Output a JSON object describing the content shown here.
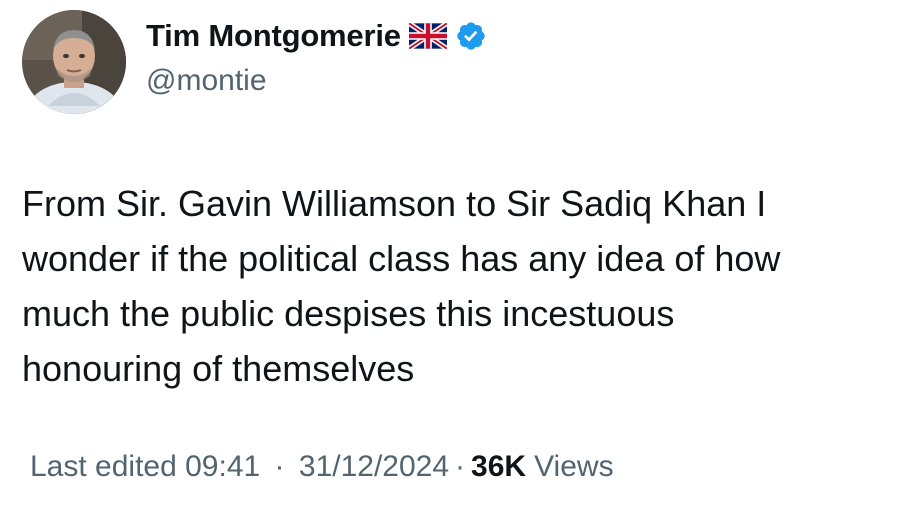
{
  "author": {
    "display_name": "Tim Montgomerie",
    "handle": "@montie",
    "flag_icon": "uk-flag-icon",
    "verified_icon": "verified-badge-icon",
    "verified_color": "#1d9bf0"
  },
  "tweet": {
    "lines": [
      "From Sir. Gavin Williamson to Sir Sadiq Khan I",
      "wonder if the political class has any idea of how",
      "much the public despises this incestuous",
      "honouring of themselves"
    ]
  },
  "meta": {
    "edited_label": "Last edited",
    "time": "09:41",
    "separator": "·",
    "date": "31/12/2024",
    "views_count": "36K",
    "views_label": "Views"
  },
  "colors": {
    "text_primary": "#0f1419",
    "text_secondary": "#536471",
    "background": "#ffffff"
  }
}
